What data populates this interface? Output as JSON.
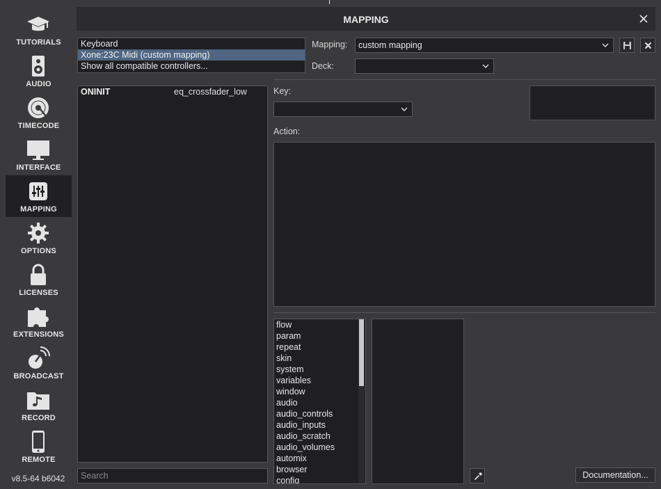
{
  "sidebar": {
    "items": [
      {
        "label": "TUTORIALS",
        "icon": "graduation-cap-icon"
      },
      {
        "label": "AUDIO",
        "icon": "speaker-icon"
      },
      {
        "label": "TIMECODE",
        "icon": "vinyl-record-icon"
      },
      {
        "label": "INTERFACE",
        "icon": "monitor-icon"
      },
      {
        "label": "MAPPING",
        "icon": "sliders-icon",
        "active": true
      },
      {
        "label": "OPTIONS",
        "icon": "gear-icon"
      },
      {
        "label": "LICENSES",
        "icon": "lock-icon"
      },
      {
        "label": "EXTENSIONS",
        "icon": "puzzle-icon"
      },
      {
        "label": "BROADCAST",
        "icon": "broadcast-icon"
      },
      {
        "label": "RECORD",
        "icon": "music-folder-icon"
      },
      {
        "label": "REMOTE",
        "icon": "phone-icon"
      }
    ],
    "version": "v8.5-64 b6042"
  },
  "header": {
    "title": "MAPPING"
  },
  "controllers": {
    "items": [
      "Keyboard",
      "Xone:23C Midi (custom mapping)",
      "Show all compatible controllers..."
    ],
    "selected_index": 1
  },
  "mapping_field": {
    "label": "Mapping:",
    "value": "custom mapping"
  },
  "deck_field": {
    "label": "Deck:",
    "value": ""
  },
  "mappings": [
    {
      "key": "ONINIT",
      "action": "eq_crossfader_low"
    }
  ],
  "search": {
    "placeholder": "Search"
  },
  "key_field": {
    "label": "Key:",
    "value": ""
  },
  "action_field": {
    "label": "Action:",
    "value": ""
  },
  "verbs": [
    "flow",
    "param",
    "repeat",
    "skin",
    "system",
    "variables",
    "window",
    "audio",
    "audio_controls",
    "audio_inputs",
    "audio_scratch",
    "audio_volumes",
    "automix",
    "browser",
    "config"
  ],
  "documentation_button": "Documentation...",
  "colors": {
    "background": "#3a3a3c",
    "panel": "#1f1f21",
    "selection": "#4f6582",
    "titlebar": "#2c2c2e"
  }
}
